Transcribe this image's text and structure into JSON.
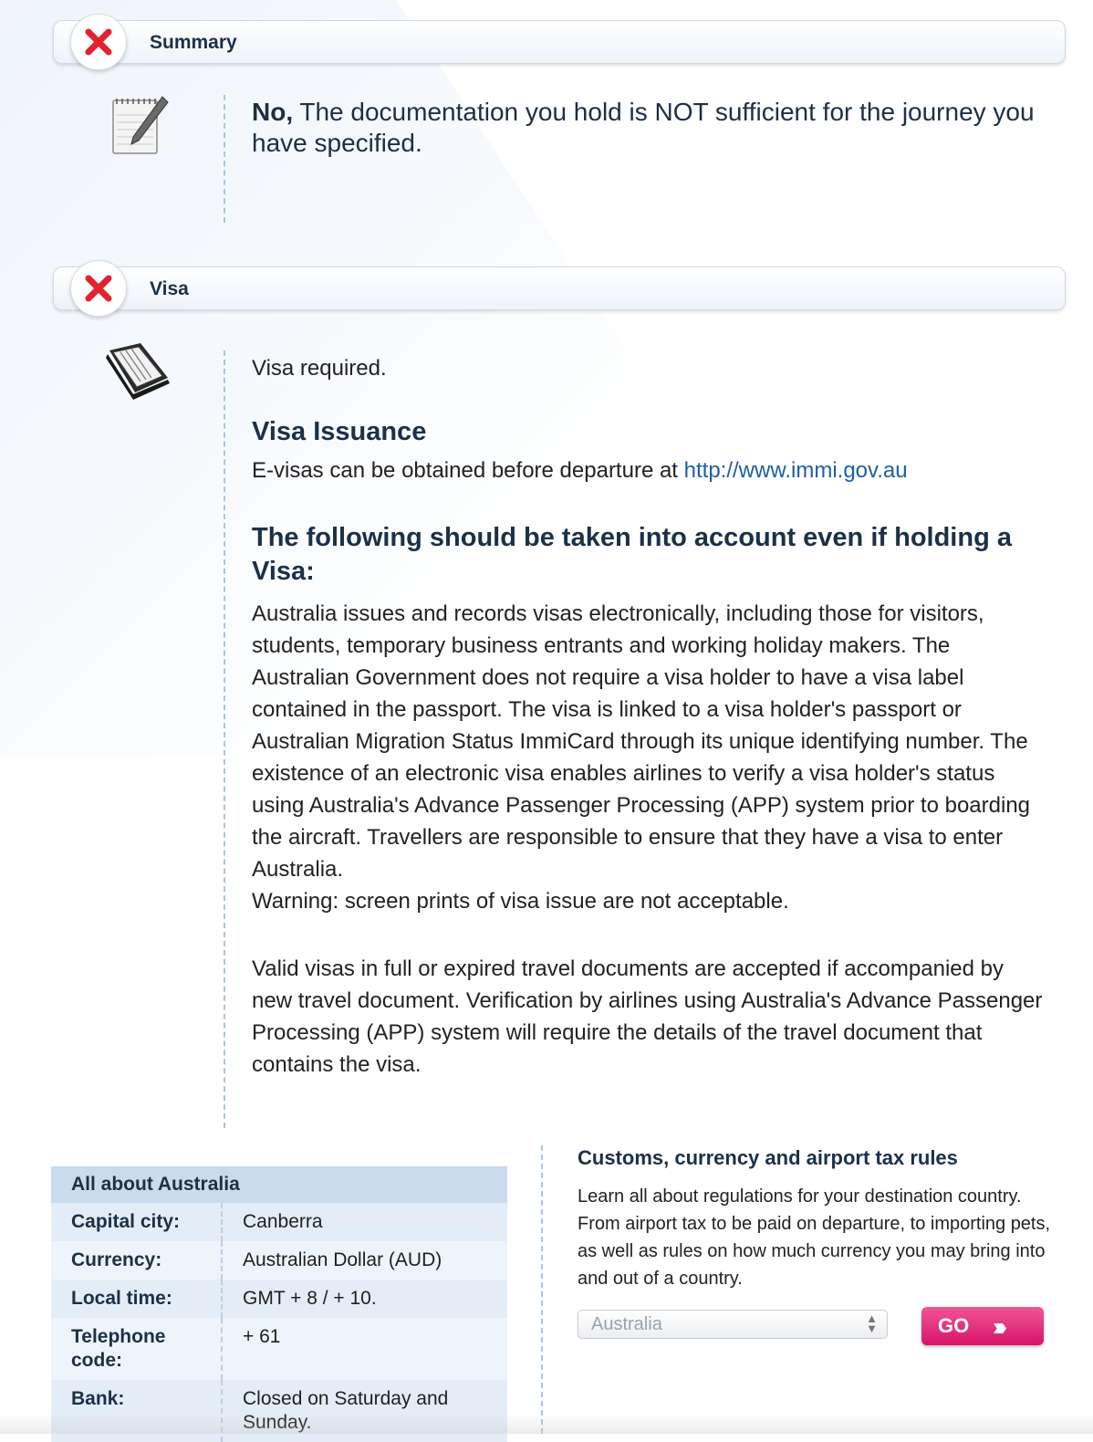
{
  "summary": {
    "title": "Summary",
    "answer": "No,",
    "text": " The documentation you hold is NOT sufficient for the journey you have specified."
  },
  "visa": {
    "title": "Visa",
    "required": "Visa required.",
    "issuance_heading": "Visa Issuance",
    "issuance_text": "E-visas can be obtained before departure at ",
    "issuance_link": "http://www.immi.gov.au",
    "account_heading": "The following should be taken into account even if holding a Visa:",
    "account_p1": "Australia issues and records visas electronically, including those for visitors, students, temporary business entrants and working holiday makers. The Australian Government does not require a visa holder to have a visa label contained in the passport. The visa is linked to a visa holder's passport or Australian Migration Status ImmiCard through its unique identifying number. The existence of an electronic visa enables airlines to verify a visa holder's status using Australia's Advance Passenger Processing (APP) system prior to boarding the aircraft. Travellers are responsible to ensure that they have a visa to enter Australia.",
    "account_warning": "Warning: screen prints of visa issue are not acceptable.",
    "account_p2": "Valid visas in full or expired travel documents are accepted if accompanied by new travel document. Verification by airlines using Australia's Advance Passenger Processing (APP) system will require the details of the travel document that contains the visa."
  },
  "about": {
    "heading": "All about Australia",
    "rows": [
      {
        "label": "Capital city:",
        "value": "Canberra"
      },
      {
        "label": "Currency:",
        "value": "Australian Dollar (AUD)"
      },
      {
        "label": "Local time:",
        "value": "GMT + 8 / + 10."
      },
      {
        "label": "Telephone code:",
        "value": "+ 61"
      },
      {
        "label": "Bank:",
        "value": "Closed on Saturday and Sunday."
      }
    ]
  },
  "customs": {
    "title": "Customs, currency and airport tax rules",
    "description": "Learn all about regulations for your destination country. From airport tax to be paid on departure, to importing pets, as well as rules on how much currency you may bring into and out of a country.",
    "select_value": "Australia",
    "go_label": "GO",
    "go_chevrons": "›››"
  },
  "colors": {
    "status_fail": "#e3222f",
    "link": "#1d5fa7",
    "go_button": "#e0256f",
    "table_header": "#c9dcee"
  }
}
